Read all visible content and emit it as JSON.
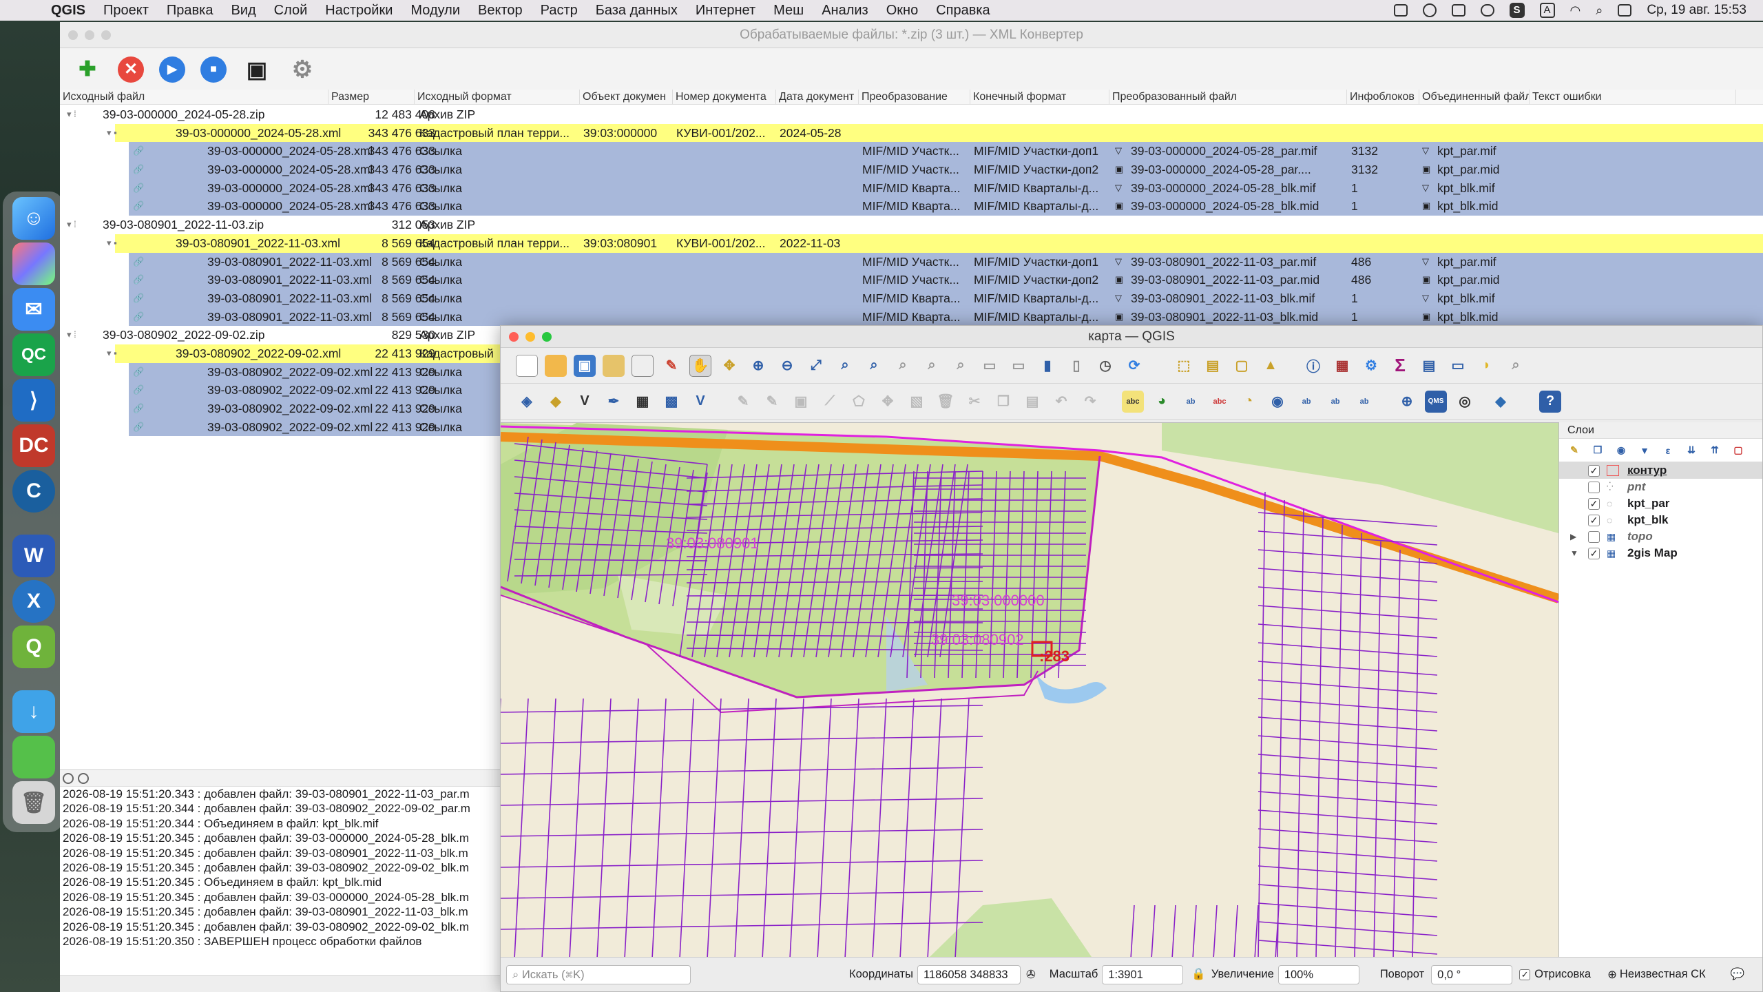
{
  "menubar": {
    "app": "QGIS",
    "items": [
      "Проект",
      "Правка",
      "Вид",
      "Слой",
      "Настройки",
      "Модули",
      "Вектор",
      "Растр",
      "База данных",
      "Интернет",
      "Меш",
      "Анализ",
      "Окно",
      "Справка"
    ],
    "right_letter": "A",
    "s_badge": "S",
    "datetime": "Ср, 19 авг. 15:53"
  },
  "converter": {
    "title": "Обрабатываемые файлы: *.zip (3 шт.) — XML Конвертер",
    "columns": [
      "Исходный файл",
      "Размер",
      "Исходный формат",
      "Объект докумен",
      "Номер документа",
      "Дата документ",
      "Преобразование",
      "Конечный формат",
      "Преобразованный файл",
      "Инфоблоков",
      "Объединенный файл",
      "Текст ошибки"
    ],
    "rows": [
      {
        "type": "zip",
        "name": "39-03-000000_2024-05-28.zip",
        "size": "12 483 408",
        "format": "Архив ZIP"
      },
      {
        "type": "xml",
        "name": "39-03-000000_2024-05-28.xml",
        "size": "343 476 633",
        "format": "Кадастровый план терри...",
        "object": "39:03:000000",
        "number": "КУВИ-001/202...",
        "date": "2024-05-28"
      },
      {
        "type": "link",
        "name": "39-03-000000_2024-05-28.xml",
        "size": "343 476 633",
        "format": "Ссылка",
        "conv": "MIF/MID Участк...",
        "final": "MIF/MID Участки-доп1",
        "out": "39-03-000000_2024-05-28_par.mif",
        "blocks": "3132",
        "merged": "kpt_par.mif",
        "icon": "mif"
      },
      {
        "type": "link",
        "name": "39-03-000000_2024-05-28.xml",
        "size": "343 476 633",
        "format": "Ссылка",
        "conv": "MIF/MID Участк...",
        "final": "MIF/MID Участки-доп2",
        "out": "39-03-000000_2024-05-28_par....",
        "blocks": "3132",
        "merged": "kpt_par.mid",
        "icon": "mid"
      },
      {
        "type": "link",
        "name": "39-03-000000_2024-05-28.xml",
        "size": "343 476 633",
        "format": "Ссылка",
        "conv": "MIF/MID Кварта...",
        "final": "MIF/MID Кварталы-д...",
        "out": "39-03-000000_2024-05-28_blk.mif",
        "blocks": "1",
        "merged": "kpt_blk.mif",
        "icon": "mif"
      },
      {
        "type": "link",
        "name": "39-03-000000_2024-05-28.xml",
        "size": "343 476 633",
        "format": "Ссылка",
        "conv": "MIF/MID Кварта...",
        "final": "MIF/MID Кварталы-д...",
        "out": "39-03-000000_2024-05-28_blk.mid",
        "blocks": "1",
        "merged": "kpt_blk.mid",
        "icon": "mid"
      },
      {
        "type": "zip",
        "name": "39-03-080901_2022-11-03.zip",
        "size": "312 053",
        "format": "Архив ZIP"
      },
      {
        "type": "xml",
        "name": "39-03-080901_2022-11-03.xml",
        "size": "8 569 654",
        "format": "Кадастровый план терри...",
        "object": "39:03:080901",
        "number": "КУВИ-001/202...",
        "date": "2022-11-03"
      },
      {
        "type": "link",
        "name": "39-03-080901_2022-11-03.xml",
        "size": "8 569 654",
        "format": "Ссылка",
        "conv": "MIF/MID Участк...",
        "final": "MIF/MID Участки-доп1",
        "out": "39-03-080901_2022-11-03_par.mif",
        "blocks": "486",
        "merged": "kpt_par.mif",
        "icon": "mif"
      },
      {
        "type": "link",
        "name": "39-03-080901_2022-11-03.xml",
        "size": "8 569 654",
        "format": "Ссылка",
        "conv": "MIF/MID Участк...",
        "final": "MIF/MID Участки-доп2",
        "out": "39-03-080901_2022-11-03_par.mid",
        "blocks": "486",
        "merged": "kpt_par.mid",
        "icon": "mid"
      },
      {
        "type": "link",
        "name": "39-03-080901_2022-11-03.xml",
        "size": "8 569 654",
        "format": "Ссылка",
        "conv": "MIF/MID Кварта...",
        "final": "MIF/MID Кварталы-д...",
        "out": "39-03-080901_2022-11-03_blk.mif",
        "blocks": "1",
        "merged": "kpt_blk.mif",
        "icon": "mif"
      },
      {
        "type": "link",
        "name": "39-03-080901_2022-11-03.xml",
        "size": "8 569 654",
        "format": "Ссылка",
        "conv": "MIF/MID Кварта...",
        "final": "MIF/MID Кварталы-д...",
        "out": "39-03-080901_2022-11-03_blk.mid",
        "blocks": "1",
        "merged": "kpt_blk.mid",
        "icon": "mid"
      },
      {
        "type": "zip",
        "name": "39-03-080902_2022-09-02.zip",
        "size": "829 530",
        "format": "Архив ZIP"
      },
      {
        "type": "xml",
        "name": "39-03-080902_2022-09-02.xml",
        "size": "22 413 929",
        "format": "Кадастровый"
      },
      {
        "type": "link",
        "name": "39-03-080902_2022-09-02.xml",
        "size": "22 413 929",
        "format": "Ссылка"
      },
      {
        "type": "link",
        "name": "39-03-080902_2022-09-02.xml",
        "size": "22 413 929",
        "format": "Ссылка"
      },
      {
        "type": "link",
        "name": "39-03-080902_2022-09-02.xml",
        "size": "22 413 929",
        "format": "Ссылка"
      },
      {
        "type": "link",
        "name": "39-03-080902_2022-09-02.xml",
        "size": "22 413 929",
        "format": "Ссылка"
      }
    ],
    "log": [
      "2026-08-19 15:51:20.343 : добавлен файл: 39-03-080901_2022-11-03_par.m",
      "2026-08-19 15:51:20.344 : добавлен файл: 39-03-080902_2022-09-02_par.m",
      "2026-08-19 15:51:20.344 : Объединяем в файл: kpt_blk.mif",
      "2026-08-19 15:51:20.345 : добавлен файл: 39-03-000000_2024-05-28_blk.m",
      "2026-08-19 15:51:20.345 : добавлен файл: 39-03-080901_2022-11-03_blk.m",
      "2026-08-19 15:51:20.345 : добавлен файл: 39-03-080902_2022-09-02_blk.m",
      "2026-08-19 15:51:20.345 : Объединяем в файл: kpt_blk.mid",
      "2026-08-19 15:51:20.345 : добавлен файл: 39-03-000000_2024-05-28_blk.m",
      "2026-08-19 15:51:20.345 : добавлен файл: 39-03-080901_2022-11-03_blk.m",
      "2026-08-19 15:51:20.345 : добавлен файл: 39-03-080902_2022-09-02_blk.m",
      "2026-08-19 15:51:20.350 : ЗАВЕРШЕН процесс обработки файлов"
    ]
  },
  "qgis": {
    "title": "карта — QGIS",
    "map_labels": [
      "39:03:080901",
      "39:03:000000",
      "39:03:080902",
      ":283"
    ],
    "layers_title": "Слои",
    "layers": [
      {
        "name": "контур",
        "checked": true,
        "italic": false,
        "selected": true
      },
      {
        "name": "pnt",
        "checked": false,
        "italic": true,
        "selected": false
      },
      {
        "name": "kpt_par",
        "checked": true,
        "italic": false,
        "selected": false
      },
      {
        "name": "kpt_blk",
        "checked": true,
        "italic": false,
        "selected": false
      },
      {
        "name": "topo",
        "checked": false,
        "italic": true,
        "selected": false
      },
      {
        "name": "2gis Map",
        "checked": true,
        "italic": false,
        "selected": false
      }
    ],
    "status": {
      "search_placeholder": "Искать (⌘K)",
      "coord_label": "Координаты",
      "coord_value": "1186058  348833",
      "scale_label": "Масштаб",
      "scale_value": "1:3901",
      "zoom_label": "Увеличение",
      "zoom_value": "100%",
      "rotation_label": "Поворот",
      "rotation_value": "0,0 °",
      "render_label": "Отрисовка",
      "crs_label": "Неизвестная СК"
    }
  }
}
